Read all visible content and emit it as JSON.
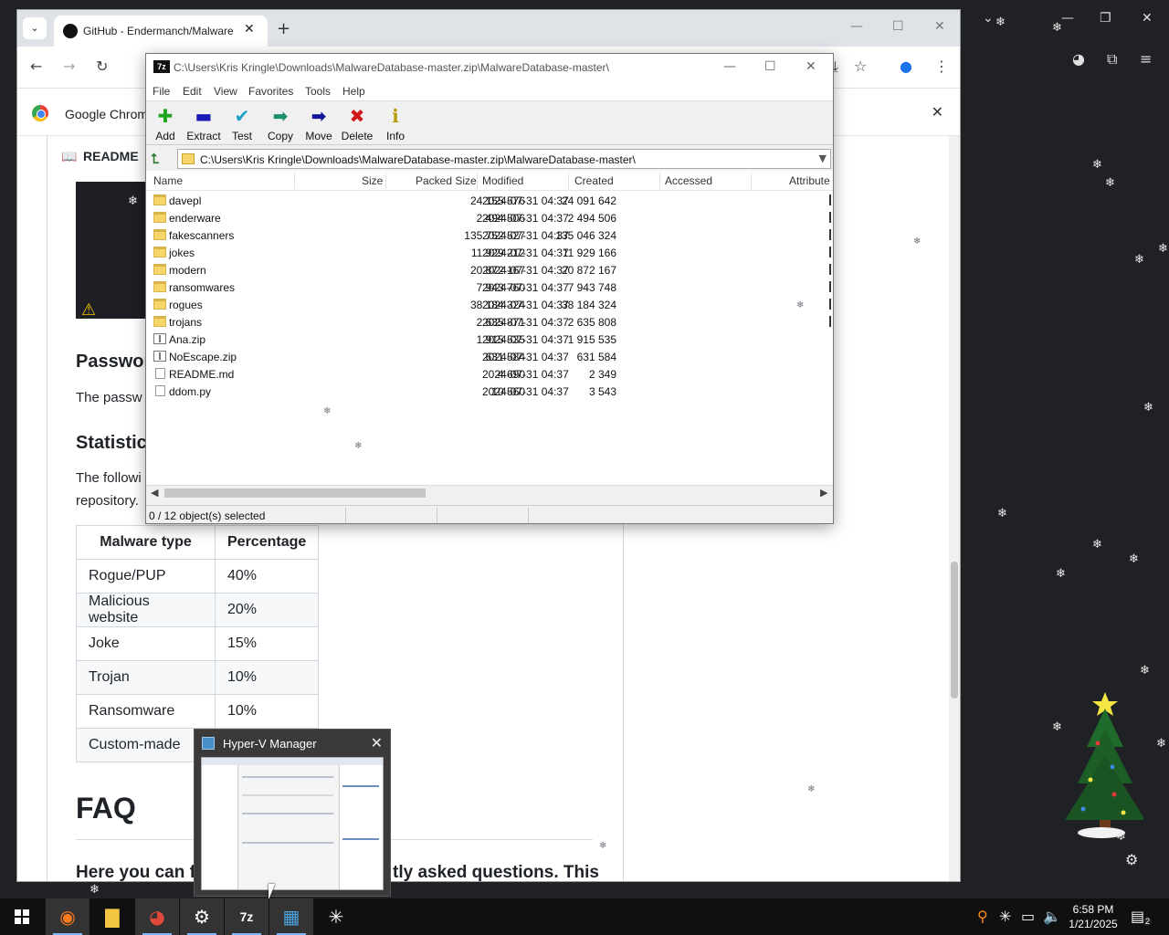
{
  "chrome": {
    "tab_title": "GitHub - Endermanch/Malware",
    "tab_close": "✕",
    "new_tab": "+",
    "minimize": "—",
    "maximize": "☐",
    "close": "✕",
    "infobar_text": "Google Chrome",
    "infobar_close": "✕"
  },
  "readme": {
    "tab_label": "README",
    "passwords_heading": "Passwor",
    "passwords_text": "The passw",
    "statistics_heading": "Statistics",
    "statistics_text_1": "The followi",
    "statistics_text_2": "repository.",
    "table": {
      "headers": [
        "Malware type",
        "Percentage"
      ],
      "rows": [
        [
          "Rogue/PUP",
          "40%"
        ],
        [
          "Malicious website",
          "20%"
        ],
        [
          "Joke",
          "15%"
        ],
        [
          "Trojan",
          "10%"
        ],
        [
          "Ransomware",
          "10%"
        ],
        [
          "Custom-made",
          ""
        ]
      ]
    },
    "faq_heading": "FAQ",
    "faq_text_left": "Here you can fi",
    "faq_text_right": "tly asked questions. This"
  },
  "zip": {
    "title": "C:\\Users\\Kris Kringle\\Downloads\\MalwareDatabase-master.zip\\MalwareDatabase-master\\",
    "logo": "7z",
    "menu": [
      "File",
      "Edit",
      "View",
      "Favorites",
      "Tools",
      "Help"
    ],
    "toolbar": [
      {
        "label": "Add",
        "icon": "plus-icon",
        "glyph": "✚",
        "color": "#1fa51f"
      },
      {
        "label": "Extract",
        "icon": "minus-icon",
        "glyph": "▬",
        "color": "#1a1ab8"
      },
      {
        "label": "Test",
        "icon": "check-icon",
        "glyph": "✔",
        "color": "#1ea0c8"
      },
      {
        "label": "Copy",
        "icon": "copy-arrow-icon",
        "glyph": "➡",
        "color": "#1e8f6e"
      },
      {
        "label": "Move",
        "icon": "move-arrow-icon",
        "glyph": "➡",
        "color": "#15159a"
      },
      {
        "label": "Delete",
        "icon": "delete-x-icon",
        "glyph": "✖",
        "color": "#d01818"
      },
      {
        "label": "Info",
        "icon": "info-icon",
        "glyph": "ℹ",
        "color": "#b89a00"
      }
    ],
    "path": "C:\\Users\\Kris Kringle\\Downloads\\MalwareDatabase-master.zip\\MalwareDatabase-master\\",
    "columns": [
      "Name",
      "Size",
      "Packed Size",
      "Modified",
      "Created",
      "Accessed",
      "Attribute"
    ],
    "rows": [
      {
        "name": "davepl",
        "size": "24 155 576",
        "packed": "24 091 642",
        "modified": "2024-07-31 04:37",
        "type": "folder"
      },
      {
        "name": "enderware",
        "size": "2 494 506",
        "packed": "2 494 506",
        "modified": "2024-07-31 04:37",
        "type": "folder"
      },
      {
        "name": "fakescanners",
        "size": "135 752 527",
        "packed": "135 046 324",
        "modified": "2024-07-31 04:37",
        "type": "folder"
      },
      {
        "name": "jokes",
        "size": "11 929 212",
        "packed": "11 929 166",
        "modified": "2024-07-31 04:37",
        "type": "folder"
      },
      {
        "name": "modern",
        "size": "20 872 167",
        "packed": "20 872 167",
        "modified": "2024-07-31 04:37",
        "type": "folder"
      },
      {
        "name": "ransomwares",
        "size": "7 943 760",
        "packed": "7 943 748",
        "modified": "2024-07-31 04:37",
        "type": "folder"
      },
      {
        "name": "rogues",
        "size": "38 184 324",
        "packed": "38 184 324",
        "modified": "2024-07-31 04:37",
        "type": "folder"
      },
      {
        "name": "trojans",
        "size": "2 635 871",
        "packed": "2 635 808",
        "modified": "2024-07-31 04:37",
        "type": "folder"
      },
      {
        "name": "Ana.zip",
        "size": "1 915 535",
        "packed": "1 915 535",
        "modified": "2024-07-31 04:37",
        "type": "zipf"
      },
      {
        "name": "NoEscape.zip",
        "size": "631 584",
        "packed": "631 584",
        "modified": "2024-07-31 04:37",
        "type": "zipf"
      },
      {
        "name": "README.md",
        "size": "4 690",
        "packed": "2 349",
        "modified": "2024-07-31 04:37",
        "type": "file"
      },
      {
        "name": "ddom.py",
        "size": "10 560",
        "packed": "3 543",
        "modified": "2024-07-31 04:37",
        "type": "file"
      }
    ],
    "status": "0 / 12 object(s) selected"
  },
  "hyperv": {
    "title": "Hyper-V Manager",
    "close": "✕"
  },
  "taskbar": {
    "time": "6:58 PM",
    "date": "1/21/2025",
    "notification_count": "2"
  },
  "colors": {
    "taskbar_bg": "#101010",
    "desktop_bg": "#1f2124",
    "tab_strip": "#dfe3e8"
  }
}
